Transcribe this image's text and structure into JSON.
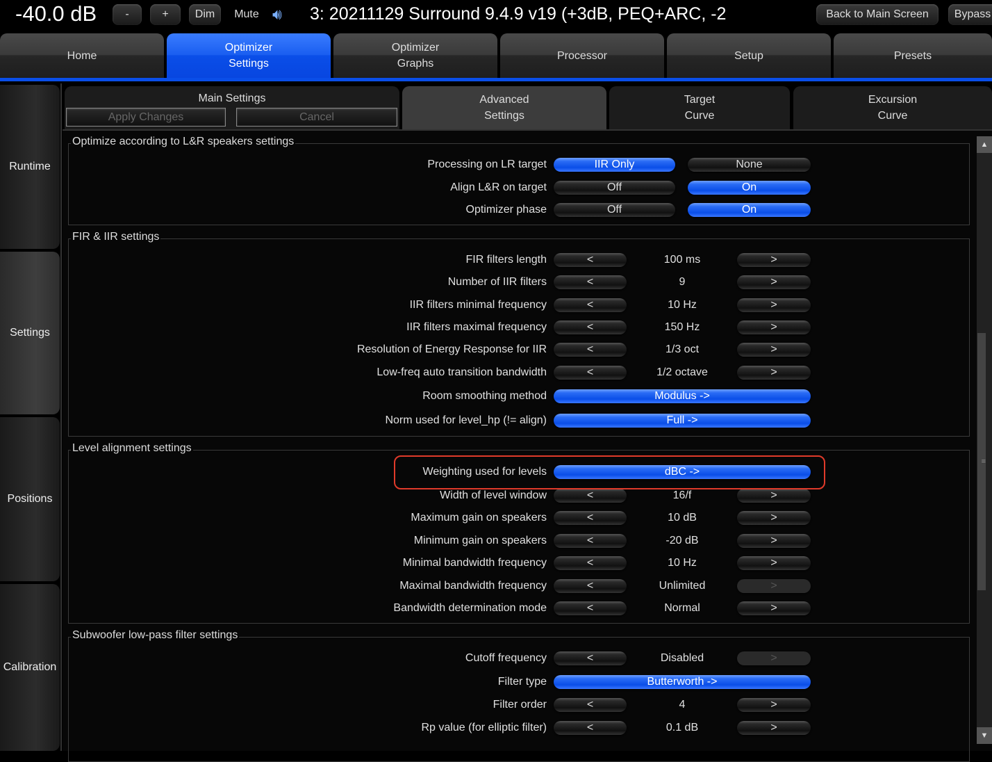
{
  "topbar": {
    "volume": "-40.0 dB",
    "minus": "-",
    "plus": "+",
    "dim": "Dim",
    "mute": "Mute",
    "speaker_icon": "speaker-volume-icon",
    "title": "3: 20211129 Surround 9.4.9 v19 (+3dB, PEQ+ARC, -2",
    "back": "Back to Main Screen",
    "bypass": "Bypass"
  },
  "main_tabs": [
    "Home",
    "Optimizer\nSettings",
    "Optimizer\nGraphs",
    "Processor",
    "Setup",
    "Presets"
  ],
  "main_tab_active": 1,
  "sidebar": [
    "Runtime",
    "Settings",
    "Positions",
    "Calibration"
  ],
  "sidebar_active": 1,
  "sub_tabs": {
    "main": "Main Settings",
    "apply": "Apply Changes",
    "cancel": "Cancel",
    "advanced": "Advanced\nSettings",
    "target": "Target\nCurve",
    "excursion": "Excursion\nCurve"
  },
  "accent": "#0a4ee8",
  "highlight_color": "#e03a2a",
  "groups": [
    {
      "title": "Optimize according to L&R speakers settings",
      "rows": [
        {
          "label": "Processing on LR target",
          "kind": "toggle",
          "a": "IIR Only",
          "b": "None",
          "selected": "a"
        },
        {
          "label": "Align L&R on target",
          "kind": "toggle",
          "a": "Off",
          "b": "On",
          "selected": "b"
        },
        {
          "label": "Optimizer phase",
          "kind": "toggle",
          "a": "Off",
          "b": "On",
          "selected": "b"
        }
      ]
    },
    {
      "title": "FIR & IIR settings",
      "rows": [
        {
          "label": "FIR filters length",
          "kind": "stepper",
          "value": "100 ms"
        },
        {
          "label": "Number of IIR filters",
          "kind": "stepper",
          "value": "9"
        },
        {
          "label": "IIR filters minimal frequency",
          "kind": "stepper",
          "value": "10 Hz"
        },
        {
          "label": "IIR filters maximal frequency",
          "kind": "stepper",
          "value": "150 Hz"
        },
        {
          "label": "Resolution of Energy Response for IIR",
          "kind": "stepper",
          "value": "1/3 oct"
        },
        {
          "label": "Low-freq auto transition bandwidth",
          "kind": "stepper",
          "value": "1/2 octave"
        },
        {
          "label": "Room smoothing method",
          "kind": "wide",
          "value": "Modulus ->"
        },
        {
          "label": "Norm used for level_hp (!= align)",
          "kind": "wide",
          "value": "Full ->"
        }
      ]
    },
    {
      "title": "Level alignment settings",
      "rows": [
        {
          "label": "Weighting used for levels",
          "kind": "wide",
          "value": "dBC ->",
          "highlighted": true
        },
        {
          "label": "Width of level window",
          "kind": "stepper",
          "value": "16/f"
        },
        {
          "label": "Maximum gain on speakers",
          "kind": "stepper",
          "value": "10 dB"
        },
        {
          "label": "Minimum gain on speakers",
          "kind": "stepper",
          "value": "-20 dB"
        },
        {
          "label": "Minimal bandwidth frequency",
          "kind": "stepper",
          "value": "10 Hz"
        },
        {
          "label": "Maximal bandwidth frequency",
          "kind": "stepper",
          "value": "Unlimited",
          "next_disabled": true
        },
        {
          "label": "Bandwidth determination mode",
          "kind": "stepper",
          "value": "Normal"
        }
      ]
    },
    {
      "title": "Subwoofer low-pass filter settings",
      "rows": [
        {
          "label": "Cutoff frequency",
          "kind": "stepper",
          "value": "Disabled",
          "next_disabled": true
        },
        {
          "label": "Filter type",
          "kind": "wide",
          "value": "Butterworth ->"
        },
        {
          "label": "Filter order",
          "kind": "stepper",
          "value": "4"
        },
        {
          "label": "Rp value (for elliptic filter)",
          "kind": "stepper",
          "value": "0.1 dB"
        }
      ]
    }
  ],
  "stepper": {
    "prev": "<",
    "next": ">"
  },
  "scrollbar": {
    "position_percent": 45
  }
}
